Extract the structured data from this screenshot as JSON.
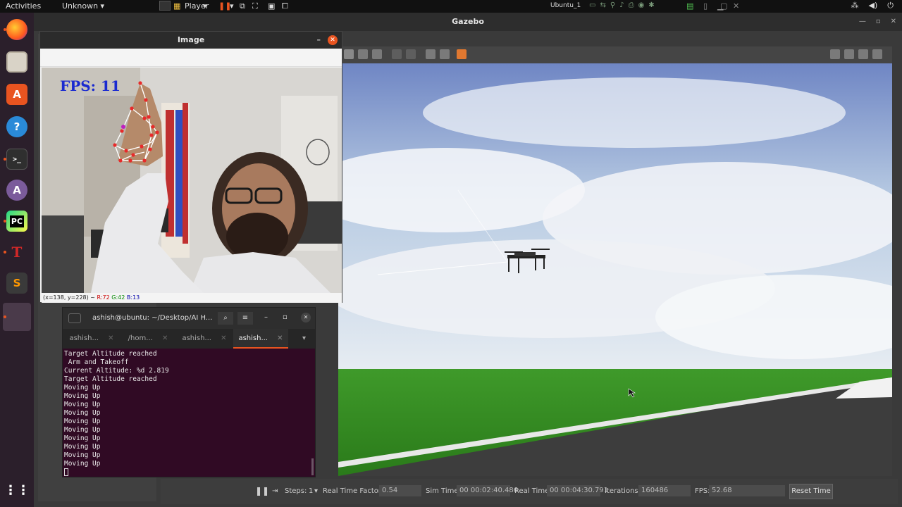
{
  "topbar": {
    "activities": "Activities",
    "unknown_menu": "Unknown ▾",
    "player_label": "Player",
    "vm_name": "Ubuntu_1"
  },
  "dock": {
    "items": [
      "firefox-icon",
      "files-icon",
      "software-center-icon",
      "help-icon",
      "terminal-icon",
      "app-store-icon",
      "pycharm-icon",
      "tex-icon",
      "sublime-icon",
      "app-grid-icon"
    ]
  },
  "gazebo": {
    "title": "Gazebo",
    "bottom": {
      "steps_label": "Steps:",
      "steps_value": "1",
      "rtf_label": "Real Time Factor:",
      "rtf_value": "0.54",
      "simtime_label": "Sim Time:",
      "simtime_value": "00 00:02:40.486",
      "realtime_label": "Real Time:",
      "realtime_value": "00 00:04:30.791",
      "iterations_label": "Iterations:",
      "iterations_value": "160486",
      "fps_label": "FPS:",
      "fps_value": "52.68",
      "reset_label": "Reset Time"
    }
  },
  "image_window": {
    "title": "Image",
    "fps_text": "FPS: 11",
    "status_coords": "(x=138, y=228) ~ ",
    "status_r": "R:72",
    "status_g": "G:42",
    "status_b": "B:13"
  },
  "terminal": {
    "title": "ashish@ubuntu: ~/Desktop/AI H...",
    "tabs": [
      "ashish...",
      "/hom...",
      "ashish...",
      "ashish..."
    ],
    "lines": [
      "Target Altitude reached",
      " Arm and Takeoff",
      "Current Altitude: %d 2.819",
      "Target Altitude reached",
      "Moving Up",
      "Moving Up",
      "Moving Up",
      "Moving Up",
      "Moving Up",
      "Moving Up",
      "Moving Up",
      "Moving Up",
      "Moving Up",
      "Moving Up"
    ]
  }
}
